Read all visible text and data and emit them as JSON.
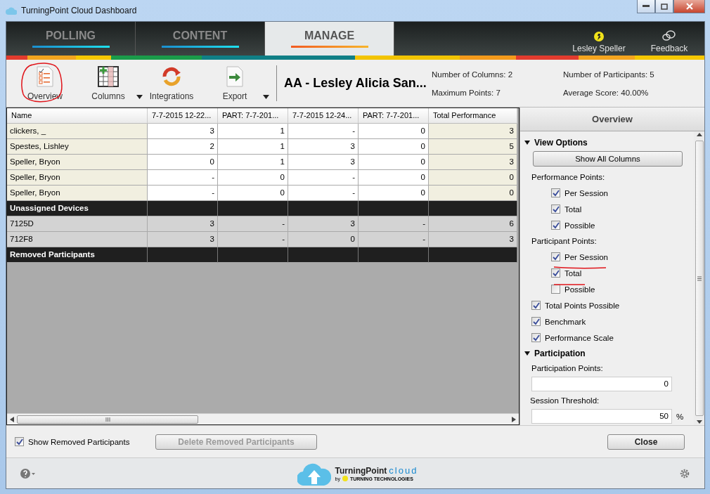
{
  "window": {
    "title": "TurningPoint Cloud Dashboard"
  },
  "nav": {
    "tabs": [
      {
        "label": "POLLING",
        "selected": false
      },
      {
        "label": "CONTENT",
        "selected": false
      },
      {
        "label": "MANAGE",
        "selected": true
      }
    ],
    "user": "Lesley Speller",
    "feedback": "Feedback"
  },
  "toolbar": {
    "buttons": [
      {
        "kind": "overview",
        "label": "Overview",
        "has_menu": false
      },
      {
        "kind": "columns",
        "label": "Columns",
        "has_menu": true
      },
      {
        "kind": "integrations",
        "label": "Integrations",
        "has_menu": false
      },
      {
        "kind": "export",
        "label": "Export",
        "has_menu": true
      }
    ],
    "course": "AA - Lesley  Alicia San...",
    "stats": [
      "Number of Columns: 2",
      "Maximum Points: 7",
      "Number of Participants: 5",
      "Average Score: 40.00%"
    ]
  },
  "table": {
    "columns": [
      "Name",
      "7-7-2015 12-22...",
      "PART: 7-7-201...",
      "7-7-2015 12-24...",
      "PART: 7-7-201...",
      "Total Performance"
    ],
    "rows": [
      {
        "kind": "participant",
        "cells": [
          "clickers, _",
          "3",
          "1",
          "-",
          "0",
          "3"
        ]
      },
      {
        "kind": "participant",
        "cells": [
          "Spestes, Lishley",
          "2",
          "1",
          "3",
          "0",
          "5"
        ]
      },
      {
        "kind": "participant",
        "cells": [
          "Speller, Bryon",
          "0",
          "1",
          "3",
          "0",
          "3"
        ]
      },
      {
        "kind": "participant",
        "cells": [
          "Speller, Bryon",
          "-",
          "0",
          "-",
          "0",
          "0"
        ]
      },
      {
        "kind": "participant",
        "cells": [
          "Speller, Bryon",
          "-",
          "0",
          "-",
          "0",
          "0"
        ]
      },
      {
        "kind": "section",
        "cells": [
          "Unassigned Devices"
        ]
      },
      {
        "kind": "device",
        "cells": [
          "7125D",
          "3",
          "-",
          "3",
          "-",
          "6"
        ]
      },
      {
        "kind": "device",
        "cells": [
          "712F8",
          "3",
          "-",
          "0",
          "-",
          "3"
        ]
      },
      {
        "kind": "section",
        "cells": [
          "Removed Participants"
        ]
      }
    ]
  },
  "panel": {
    "title": "Overview",
    "items": [
      {
        "kind": "heading",
        "label": "View Options",
        "expanded": true
      },
      {
        "kind": "button",
        "label": "Show All Columns"
      },
      {
        "kind": "label",
        "label": "Performance Points:"
      },
      {
        "kind": "checkbox",
        "label": "Per Session",
        "checked": true,
        "nested": true
      },
      {
        "kind": "checkbox",
        "label": "Total",
        "checked": true,
        "nested": true
      },
      {
        "kind": "checkbox",
        "label": "Possible",
        "checked": true,
        "nested": true
      },
      {
        "kind": "label",
        "label": "Participant Points:"
      },
      {
        "kind": "checkbox",
        "label": "Per Session",
        "checked": true,
        "nested": true
      },
      {
        "kind": "checkbox",
        "label": "Total",
        "checked": true,
        "nested": true
      },
      {
        "kind": "checkbox",
        "label": "Possible",
        "checked": false,
        "nested": true
      },
      {
        "kind": "checkbox",
        "label": "Total Points Possible",
        "checked": true,
        "nested": false
      },
      {
        "kind": "checkbox",
        "label": "Benchmark",
        "checked": true,
        "nested": false
      },
      {
        "kind": "checkbox",
        "label": "Performance Scale",
        "checked": true,
        "nested": false
      },
      {
        "kind": "heading",
        "label": "Participation",
        "expanded": true
      },
      {
        "kind": "label",
        "label": "Participation Points:"
      },
      {
        "kind": "field",
        "value": "0"
      },
      {
        "kind": "label",
        "label": "Session Threshold:"
      },
      {
        "kind": "field",
        "value": "50",
        "unit": "%"
      }
    ]
  },
  "bottom": {
    "show_removed": {
      "label": "Show Removed Participants",
      "checked": true
    },
    "delete_button": {
      "label": "Delete Removed Participants",
      "disabled": true
    },
    "close_button": {
      "label": "Close"
    }
  },
  "footer": {
    "brand": "TurningPoint",
    "cloud": "cloud",
    "by": "by",
    "company": "TURNING TECHNOLOGIES"
  }
}
